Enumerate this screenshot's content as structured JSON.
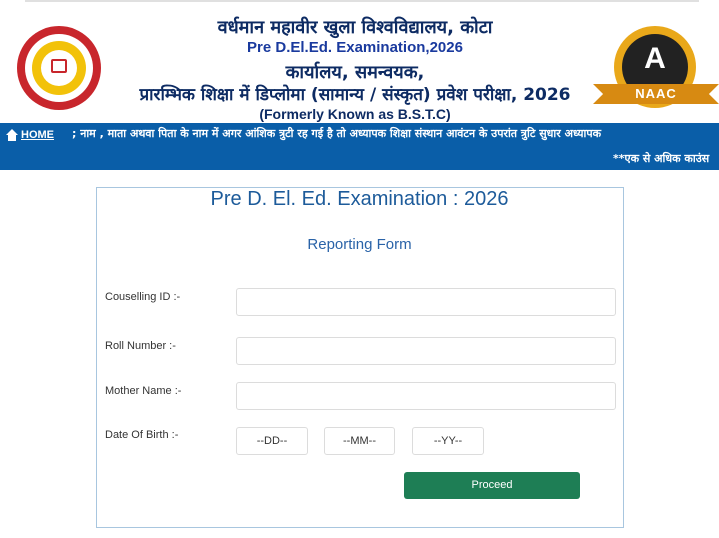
{
  "header": {
    "university_hindi": "वर्धमान महावीर खुला विश्वविद्यालय, कोटा",
    "exam_title": "Pre D.El.Ed. Examination,2026",
    "office_hindi": "कार्यालय, समन्वयक,",
    "exam_hindi": "प्रारम्भिक शिक्षा में डिप्लोमा (सामान्य / संस्कृत) प्रवेश परीक्षा, 2026",
    "formerly": "(Formerly Known as B.S.T.C)",
    "naac_grade": "A",
    "naac_label": "NAAC"
  },
  "nav": {
    "home_label": "HOME",
    "marquee_text": "; नाम , माता अथवा पिता के नाम में अगर आंशिक त्रुटी रह गई है तो अध्यापक शिक्षा संस्थान आवंटन के उपरांत त्रुटि सुधार अध्यापक",
    "notice_text": "**एक से अधिक काउंस"
  },
  "form": {
    "title": "Pre D. El. Ed. Examination : 2026",
    "subtitle": "Reporting Form",
    "counselling_label": "Couselling ID :-",
    "roll_label": "Roll Number :-",
    "mother_label": "Mother Name :-",
    "dob_label": "Date Of Birth :-",
    "dd_value": "--DD--",
    "mm_value": "--MM--",
    "yy_value": "--YY--",
    "proceed_label": "Proceed"
  },
  "colors": {
    "nav_bg": "#0a5ea8",
    "title_blue": "#1d5b9a",
    "button_green": "#1e7e55"
  }
}
